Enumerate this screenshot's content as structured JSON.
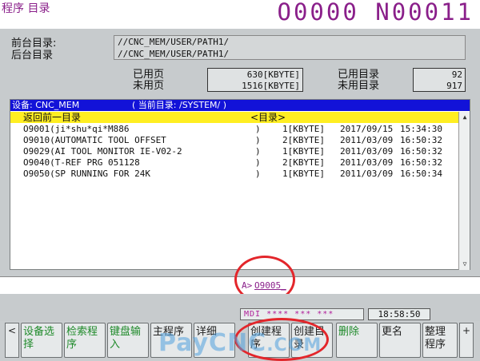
{
  "header": {
    "screen_title": "程序 目录",
    "program_number": "O0000 N00011"
  },
  "directory": {
    "foreground_label": "前台目录:",
    "background_label": "后台目录",
    "foreground_path": "//CNC_MEM/USER/PATH1/",
    "background_path": "//CNC_MEM/USER/PATH1/"
  },
  "memory": {
    "used_pages_label": "已用页",
    "free_pages_label": "未用页",
    "used_pages_value": "630[KBYTE]",
    "free_pages_value": "1516[KBYTE]",
    "used_dirs_label": "已用目录",
    "free_dirs_label": "未用目录",
    "used_dirs_value": "92",
    "free_dirs_value": "917"
  },
  "list_header": {
    "device_label": "设备: CNC_MEM",
    "current_dir": "( 当前目录: /SYSTEM/ )"
  },
  "back_row": {
    "label": "返回前一目录",
    "type": "<目录>"
  },
  "files": [
    {
      "name": "O9001(ji*shu*qi*M886",
      "paren": ")",
      "size": "1[KBYTE]",
      "date": "2017/09/15",
      "time": "15:34:30"
    },
    {
      "name": "O9010(AUTOMATIC TOOL OFFSET",
      "paren": ")",
      "size": "2[KBYTE]",
      "date": "2011/03/09",
      "time": "16:50:32"
    },
    {
      "name": "O9029(AI TOOL MONITOR IE-V02-2",
      "paren": ")",
      "size": "1[KBYTE]",
      "date": "2011/03/09",
      "time": "16:50:32"
    },
    {
      "name": "O9040(T-REF PRG 051128",
      "paren": ")",
      "size": "2[KBYTE]",
      "date": "2011/03/09",
      "time": "16:50:32"
    },
    {
      "name": "O9050(SP RUNNING FOR 24K",
      "paren": ")",
      "size": "1[KBYTE]",
      "date": "2011/03/09",
      "time": "16:50:34"
    }
  ],
  "input": {
    "prompt": "A>",
    "text": "O9005_"
  },
  "status": {
    "mode": "MDI **** *** ***",
    "clock": "18:58:50"
  },
  "softkeys": {
    "left_arrow": "<",
    "right_arrow": "+",
    "keys": [
      {
        "label": "设备选择",
        "style": "green"
      },
      {
        "label": "检索程序",
        "style": "green"
      },
      {
        "label": "键盘输入",
        "style": "green"
      },
      {
        "label": "主程序",
        "style": "dark"
      },
      {
        "label": "详细",
        "style": "dark"
      },
      {
        "label": "创建程序",
        "style": "dark"
      },
      {
        "label": "创建目录",
        "style": "dark"
      },
      {
        "label": "删除",
        "style": "green"
      },
      {
        "label": "更名",
        "style": "dark"
      },
      {
        "label": "整理程序",
        "style": "dark"
      }
    ]
  },
  "watermark": {
    "main": "PayCNC",
    "suffix": ".COM"
  },
  "colors": {
    "title_magenta": "#8a1f8a",
    "header_blue": "#1212d8",
    "highlight_yellow": "#ffee22",
    "softkey_green": "#1f8a2a",
    "annotation_red": "#e3262b"
  }
}
